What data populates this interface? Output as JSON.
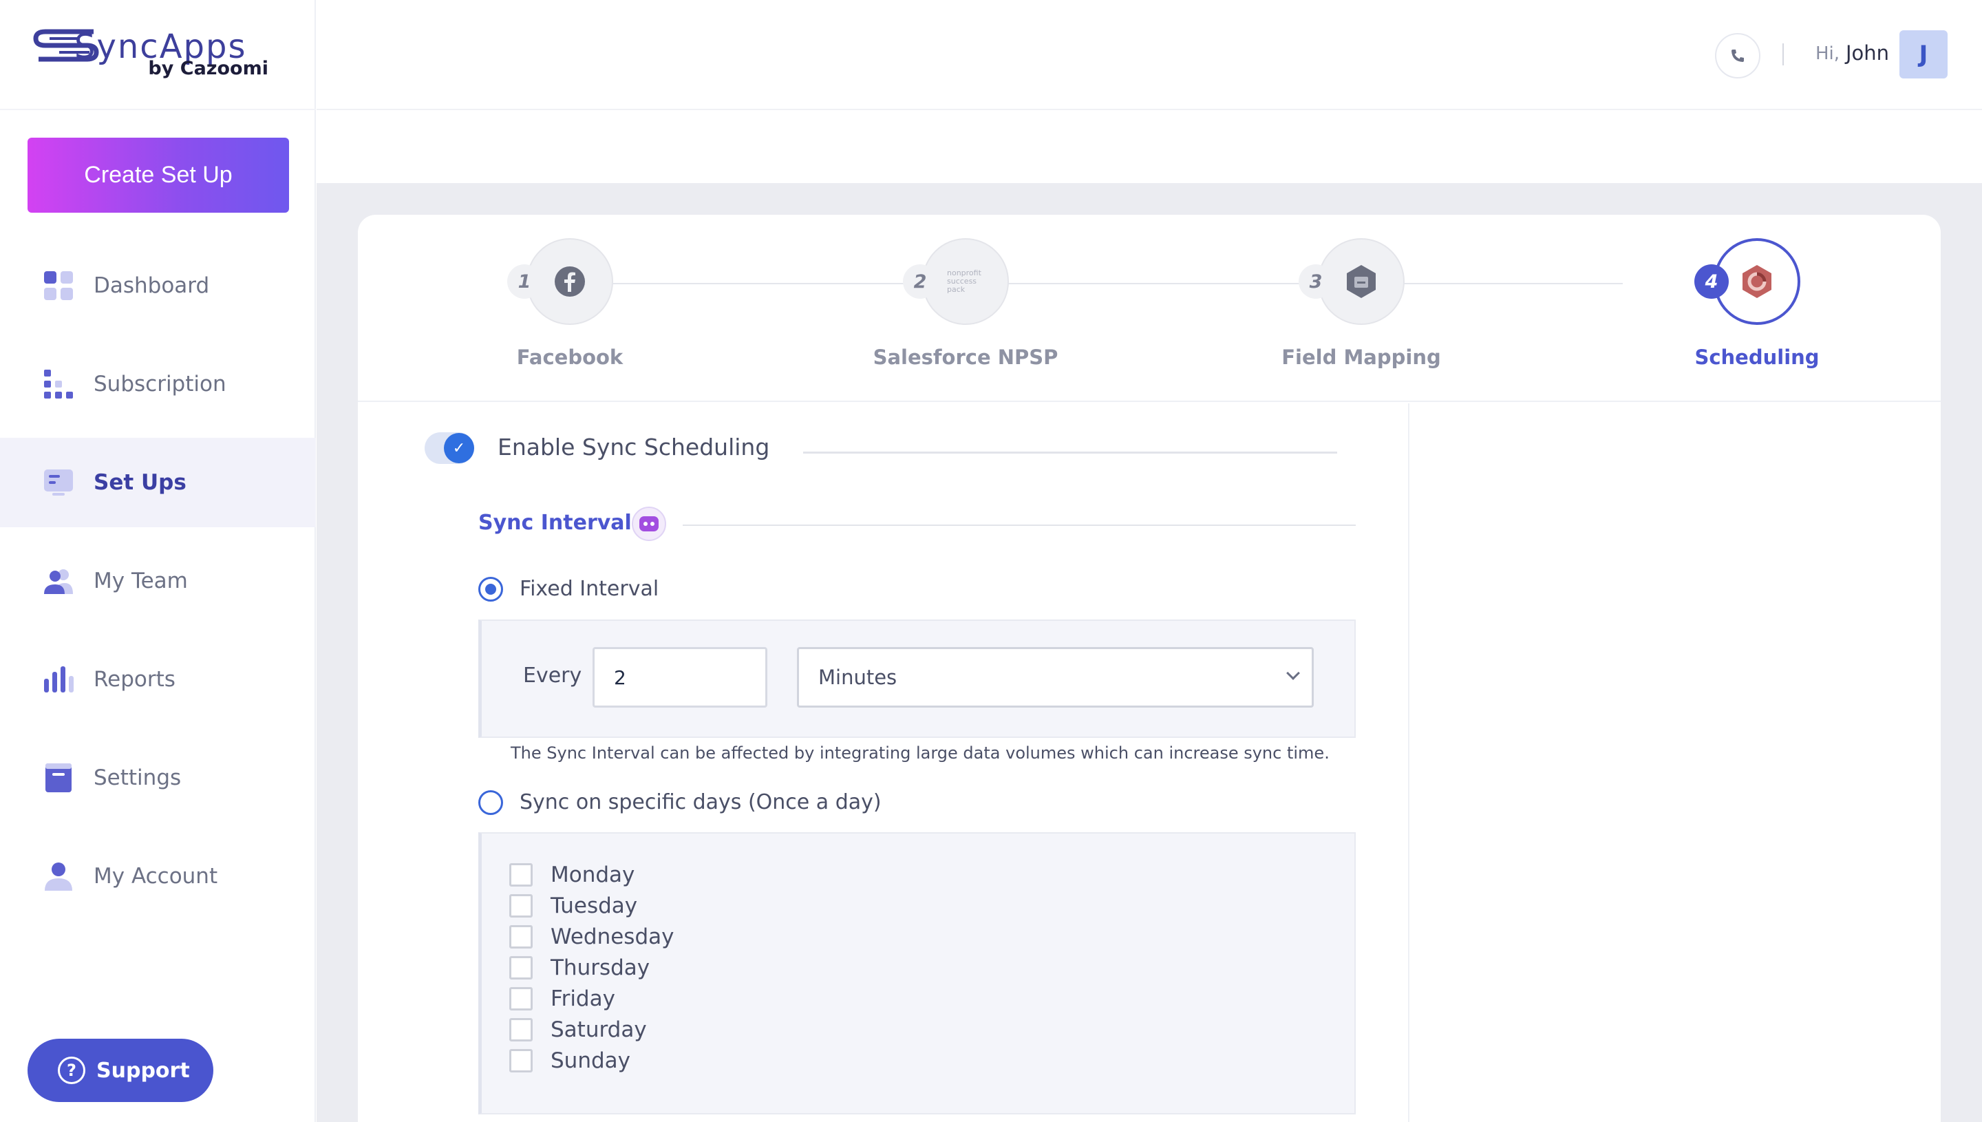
{
  "brand": {
    "name": "SyncApps",
    "tagline": "by Cazoomi"
  },
  "sidebar": {
    "create_button": "Create Set Up",
    "items": [
      {
        "label": "Dashboard",
        "icon": "dashboard-icon"
      },
      {
        "label": "Subscription",
        "icon": "subscription-icon"
      },
      {
        "label": "Set Ups",
        "icon": "setups-icon",
        "active": true
      },
      {
        "label": "My Team",
        "icon": "team-icon"
      },
      {
        "label": "Reports",
        "icon": "reports-icon"
      },
      {
        "label": "Settings",
        "icon": "settings-icon"
      },
      {
        "label": "My Account",
        "icon": "account-icon"
      }
    ],
    "support_label": "Support"
  },
  "header": {
    "greeting": "Hi,",
    "user_name": "John",
    "avatar_initial": "J"
  },
  "stepper": {
    "steps": [
      {
        "number": "1",
        "label": "Facebook",
        "icon": "facebook-icon"
      },
      {
        "number": "2",
        "label": "Salesforce NPSP",
        "icon": "nonprofit-success-pack-icon",
        "icon_text": "nonprofit success pack"
      },
      {
        "number": "3",
        "label": "Field Mapping",
        "icon": "field-mapping-icon"
      },
      {
        "number": "4",
        "label": "Scheduling",
        "icon": "scheduling-icon",
        "active": true
      }
    ]
  },
  "scheduling": {
    "enable_label": "Enable Sync Scheduling",
    "enabled": true,
    "interval_title": "Sync Interval",
    "fixed_label": "Fixed Interval",
    "every_label": "Every",
    "every_value": "2",
    "unit_selected": "Minutes",
    "note": "The Sync Interval can be affected by integrating large data volumes which can increase sync time.",
    "specific_days_label": "Sync on specific days (Once a day)",
    "days": [
      "Monday",
      "Tuesday",
      "Wednesday",
      "Thursday",
      "Friday",
      "Saturday",
      "Sunday"
    ]
  },
  "colors": {
    "accent": "#4b56cf",
    "gradient_start": "#d342f2",
    "gradient_end": "#6f58ee",
    "toggle": "#2f6fe0"
  }
}
